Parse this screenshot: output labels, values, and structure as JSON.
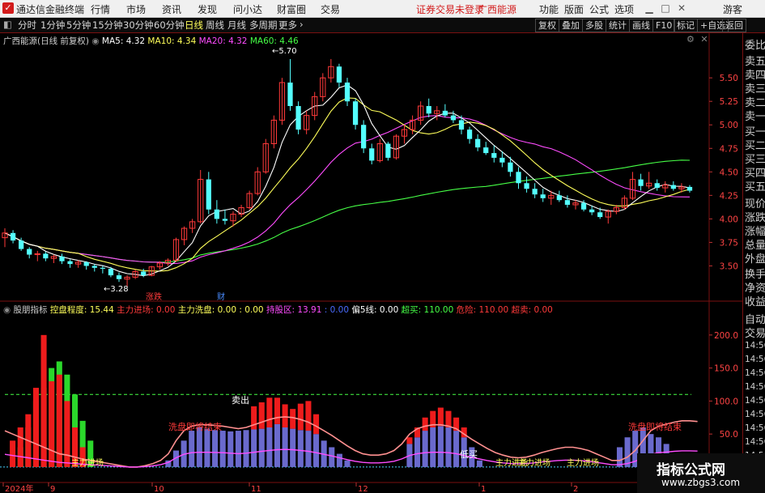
{
  "app": {
    "title": "通达信金融终端",
    "menu": [
      "行情",
      "市场",
      "资讯",
      "发现",
      "问小达",
      "财富圈",
      "交易"
    ],
    "alert": "证券交易未登录",
    "stock_name": "广西能源",
    "right_menu": [
      "功能",
      "版面",
      "公式",
      "选项"
    ],
    "guest": "游客"
  },
  "periods": [
    "分时",
    "1分钟",
    "5分钟",
    "15分钟",
    "30分钟",
    "60分钟",
    "日线",
    "周线",
    "月线",
    "多周期",
    "更多"
  ],
  "active_period": "日线",
  "toolbar": [
    "复权",
    "叠加",
    "多股",
    "统计",
    "画线",
    "F10",
    "标记",
    "+自选",
    "返回"
  ],
  "chart_header": {
    "stock_label": "广西能源(日线 前复权)",
    "ma": [
      {
        "label": "MA5: 4.32",
        "color": "#ffffff"
      },
      {
        "label": "MA10: 4.34",
        "color": "#ffff5a"
      },
      {
        "label": "MA20: 4.32",
        "color": "#ff4cff"
      },
      {
        "label": "MA60: 4.46",
        "color": "#46ff46"
      }
    ]
  },
  "indicator_header": {
    "name": "股朋指标",
    "items": [
      {
        "label": "控盘程度: 15.44",
        "color": "#ffff5a"
      },
      {
        "label": "主力进场: 0.00",
        "color": "#ff3a3a"
      },
      {
        "label": "主力洗盘: 0.00",
        "color": "#ffff5a"
      },
      {
        "label": ": 0.00",
        "color": "#ffff5a"
      },
      {
        "label": "持股区: 13.91",
        "color": "#ff4cff"
      },
      {
        "label": ": 0.00",
        "color": "#4a6bff"
      },
      {
        "label": "偏5线: 0.00",
        "color": "#ffffff"
      },
      {
        "label": "超买: 110.00",
        "color": "#46ff46"
      },
      {
        "label": "危险: 110.00",
        "color": "#ff3a3a"
      },
      {
        "label": "超卖: 0.00",
        "color": "#ff3a3a"
      }
    ]
  },
  "sidebar_labels": [
    "委比",
    "卖五",
    "卖四",
    "卖三",
    "卖二",
    "卖一",
    "买一",
    "买二",
    "买三",
    "买四",
    "买五",
    "现价",
    "涨跌",
    "涨幅",
    "总量",
    "外盘",
    "换手",
    "净资",
    "收益",
    "自动",
    "交易"
  ],
  "sidebar_times": [
    "14:56",
    "14:56",
    "14:56",
    "14:56",
    "14:56",
    "14:56",
    "14:56",
    "14:56",
    "14:56"
  ],
  "annotations": {
    "high": "5.70",
    "low": "3.28",
    "sell": "卖出",
    "low_buy": "低买",
    "buy_texts": [
      "主力进场",
      "主力进场",
      "主力进场",
      "主力进场"
    ],
    "wash_end": [
      "洗盘即将结束",
      "洗盘即将结束"
    ],
    "markers": [
      "涨跌",
      "财"
    ]
  },
  "x_labels": [
    "2024年",
    "9",
    "10",
    "11",
    "12",
    "1",
    "2"
  ],
  "watermark": {
    "line1": "指标公式网",
    "line2": "www.zbgs3.com"
  },
  "chart_data": {
    "type": "candlestick",
    "price_axis": {
      "ticks": [
        3.5,
        3.75,
        4.0,
        4.25,
        4.5,
        4.75,
        5.0,
        5.25,
        5.5
      ],
      "range": [
        3.22,
        5.82
      ]
    },
    "candles": [
      {
        "o": 3.8,
        "h": 3.9,
        "l": 3.7,
        "c": 3.85
      },
      {
        "o": 3.85,
        "h": 3.88,
        "l": 3.74,
        "c": 3.77
      },
      {
        "o": 3.77,
        "h": 3.8,
        "l": 3.66,
        "c": 3.68
      },
      {
        "o": 3.68,
        "h": 3.7,
        "l": 3.58,
        "c": 3.62
      },
      {
        "o": 3.62,
        "h": 3.66,
        "l": 3.55,
        "c": 3.63
      },
      {
        "o": 3.63,
        "h": 3.65,
        "l": 3.55,
        "c": 3.58
      },
      {
        "o": 3.58,
        "h": 3.62,
        "l": 3.53,
        "c": 3.6
      },
      {
        "o": 3.6,
        "h": 3.63,
        "l": 3.52,
        "c": 3.55
      },
      {
        "o": 3.55,
        "h": 3.57,
        "l": 3.48,
        "c": 3.52
      },
      {
        "o": 3.52,
        "h": 3.56,
        "l": 3.48,
        "c": 3.54
      },
      {
        "o": 3.54,
        "h": 3.55,
        "l": 3.46,
        "c": 3.5
      },
      {
        "o": 3.5,
        "h": 3.52,
        "l": 3.44,
        "c": 3.48
      },
      {
        "o": 3.48,
        "h": 3.5,
        "l": 3.42,
        "c": 3.47
      },
      {
        "o": 3.47,
        "h": 3.49,
        "l": 3.38,
        "c": 3.4
      },
      {
        "o": 3.4,
        "h": 3.43,
        "l": 3.33,
        "c": 3.36
      },
      {
        "o": 3.36,
        "h": 3.4,
        "l": 3.28,
        "c": 3.38
      },
      {
        "o": 3.38,
        "h": 3.46,
        "l": 3.36,
        "c": 3.44
      },
      {
        "o": 3.44,
        "h": 3.47,
        "l": 3.38,
        "c": 3.4
      },
      {
        "o": 3.4,
        "h": 3.5,
        "l": 3.39,
        "c": 3.49
      },
      {
        "o": 3.49,
        "h": 3.55,
        "l": 3.46,
        "c": 3.53
      },
      {
        "o": 3.53,
        "h": 3.58,
        "l": 3.5,
        "c": 3.56
      },
      {
        "o": 3.56,
        "h": 3.8,
        "l": 3.54,
        "c": 3.78
      },
      {
        "o": 3.78,
        "h": 3.92,
        "l": 3.72,
        "c": 3.9
      },
      {
        "o": 3.9,
        "h": 4.0,
        "l": 3.85,
        "c": 3.97
      },
      {
        "o": 3.97,
        "h": 4.52,
        "l": 3.95,
        "c": 4.42
      },
      {
        "o": 4.42,
        "h": 4.5,
        "l": 4.05,
        "c": 4.1
      },
      {
        "o": 4.1,
        "h": 4.2,
        "l": 3.95,
        "c": 4.0
      },
      {
        "o": 4.0,
        "h": 4.1,
        "l": 3.94,
        "c": 3.98
      },
      {
        "o": 3.98,
        "h": 4.08,
        "l": 3.92,
        "c": 4.05
      },
      {
        "o": 4.05,
        "h": 4.15,
        "l": 4.02,
        "c": 4.12
      },
      {
        "o": 4.12,
        "h": 4.3,
        "l": 4.1,
        "c": 4.27
      },
      {
        "o": 4.27,
        "h": 4.55,
        "l": 4.25,
        "c": 4.5
      },
      {
        "o": 4.5,
        "h": 4.85,
        "l": 4.48,
        "c": 4.8
      },
      {
        "o": 4.8,
        "h": 5.1,
        "l": 4.75,
        "c": 5.05
      },
      {
        "o": 5.05,
        "h": 5.5,
        "l": 5.0,
        "c": 5.45
      },
      {
        "o": 5.45,
        "h": 5.7,
        "l": 5.15,
        "c": 5.2
      },
      {
        "o": 5.2,
        "h": 5.25,
        "l": 4.9,
        "c": 4.95
      },
      {
        "o": 4.95,
        "h": 5.15,
        "l": 4.9,
        "c": 5.1
      },
      {
        "o": 5.1,
        "h": 5.35,
        "l": 5.05,
        "c": 5.3
      },
      {
        "o": 5.3,
        "h": 5.55,
        "l": 5.25,
        "c": 5.5
      },
      {
        "o": 5.5,
        "h": 5.7,
        "l": 5.45,
        "c": 5.62
      },
      {
        "o": 5.62,
        "h": 5.65,
        "l": 5.4,
        "c": 5.45
      },
      {
        "o": 5.45,
        "h": 5.5,
        "l": 5.2,
        "c": 5.25
      },
      {
        "o": 5.25,
        "h": 5.28,
        "l": 4.95,
        "c": 5.0
      },
      {
        "o": 5.0,
        "h": 5.05,
        "l": 4.7,
        "c": 4.75
      },
      {
        "o": 4.75,
        "h": 4.8,
        "l": 4.58,
        "c": 4.62
      },
      {
        "o": 4.62,
        "h": 4.85,
        "l": 4.6,
        "c": 4.8
      },
      {
        "o": 4.8,
        "h": 4.82,
        "l": 4.62,
        "c": 4.65
      },
      {
        "o": 4.65,
        "h": 4.9,
        "l": 4.63,
        "c": 4.88
      },
      {
        "o": 4.88,
        "h": 5.0,
        "l": 4.8,
        "c": 4.95
      },
      {
        "o": 4.95,
        "h": 5.1,
        "l": 4.9,
        "c": 5.05
      },
      {
        "o": 5.05,
        "h": 5.25,
        "l": 5.0,
        "c": 5.2
      },
      {
        "o": 5.2,
        "h": 5.28,
        "l": 5.08,
        "c": 5.12
      },
      {
        "o": 5.12,
        "h": 5.2,
        "l": 5.05,
        "c": 5.15
      },
      {
        "o": 5.15,
        "h": 5.22,
        "l": 5.08,
        "c": 5.1
      },
      {
        "o": 5.1,
        "h": 5.15,
        "l": 5.02,
        "c": 5.05
      },
      {
        "o": 5.05,
        "h": 5.1,
        "l": 4.9,
        "c": 4.95
      },
      {
        "o": 4.95,
        "h": 4.98,
        "l": 4.8,
        "c": 4.85
      },
      {
        "o": 4.85,
        "h": 4.9,
        "l": 4.72,
        "c": 4.76
      },
      {
        "o": 4.76,
        "h": 4.82,
        "l": 4.68,
        "c": 4.7
      },
      {
        "o": 4.7,
        "h": 4.78,
        "l": 4.6,
        "c": 4.65
      },
      {
        "o": 4.65,
        "h": 4.72,
        "l": 4.55,
        "c": 4.6
      },
      {
        "o": 4.6,
        "h": 4.66,
        "l": 4.45,
        "c": 4.5
      },
      {
        "o": 4.5,
        "h": 4.55,
        "l": 4.32,
        "c": 4.38
      },
      {
        "o": 4.38,
        "h": 4.45,
        "l": 4.28,
        "c": 4.32
      },
      {
        "o": 4.32,
        "h": 4.38,
        "l": 4.22,
        "c": 4.26
      },
      {
        "o": 4.26,
        "h": 4.32,
        "l": 4.18,
        "c": 4.22
      },
      {
        "o": 4.22,
        "h": 4.3,
        "l": 4.15,
        "c": 4.25
      },
      {
        "o": 4.25,
        "h": 4.3,
        "l": 4.18,
        "c": 4.2
      },
      {
        "o": 4.2,
        "h": 4.25,
        "l": 4.12,
        "c": 4.15
      },
      {
        "o": 4.15,
        "h": 4.2,
        "l": 4.1,
        "c": 4.17
      },
      {
        "o": 4.17,
        "h": 4.2,
        "l": 4.08,
        "c": 4.1
      },
      {
        "o": 4.1,
        "h": 4.14,
        "l": 4.04,
        "c": 4.07
      },
      {
        "o": 4.07,
        "h": 4.12,
        "l": 4.0,
        "c": 4.02
      },
      {
        "o": 4.02,
        "h": 4.1,
        "l": 3.95,
        "c": 4.08
      },
      {
        "o": 4.08,
        "h": 4.15,
        "l": 4.05,
        "c": 4.12
      },
      {
        "o": 4.12,
        "h": 4.25,
        "l": 4.1,
        "c": 4.22
      },
      {
        "o": 4.22,
        "h": 4.5,
        "l": 4.2,
        "c": 4.42
      },
      {
        "o": 4.42,
        "h": 4.48,
        "l": 4.3,
        "c": 4.35
      },
      {
        "o": 4.35,
        "h": 4.5,
        "l": 4.32,
        "c": 4.38
      },
      {
        "o": 4.38,
        "h": 4.42,
        "l": 4.3,
        "c": 4.33
      },
      {
        "o": 4.33,
        "h": 4.4,
        "l": 4.28,
        "c": 4.36
      },
      {
        "o": 4.36,
        "h": 4.4,
        "l": 4.3,
        "c": 4.32
      },
      {
        "o": 4.32,
        "h": 4.38,
        "l": 4.28,
        "c": 4.34
      },
      {
        "o": 4.34,
        "h": 4.36,
        "l": 4.28,
        "c": 4.3
      }
    ],
    "indicator": {
      "y_ticks": [
        50,
        100,
        150,
        200
      ],
      "range": [
        -5,
        228
      ],
      "bars_red": [
        0,
        40,
        60,
        80,
        120,
        200,
        130,
        140,
        100,
        60,
        30,
        0,
        0,
        0,
        0,
        0,
        0,
        0,
        0,
        0,
        0,
        0,
        0,
        0,
        0,
        0,
        0,
        0,
        0,
        0,
        0,
        0,
        0,
        0,
        0,
        0,
        0,
        0,
        0,
        0,
        0,
        0,
        0,
        0,
        0,
        0,
        0,
        0,
        0,
        0,
        0,
        0,
        0,
        0,
        0,
        0,
        0,
        0,
        0,
        0,
        0,
        0,
        0,
        0,
        0,
        0,
        0,
        0,
        0,
        0,
        0,
        0,
        0,
        0,
        0,
        0,
        0,
        0,
        0,
        0,
        0,
        0,
        0,
        0,
        0,
        0,
        0,
        0,
        0
      ],
      "bars_green": [
        0,
        0,
        30,
        60,
        100,
        120,
        150,
        160,
        140,
        110,
        70,
        40,
        0,
        0,
        0,
        0,
        0,
        0,
        0,
        0,
        0,
        0,
        0,
        0,
        0,
        0,
        0,
        0,
        0,
        0,
        0,
        0,
        0,
        0,
        0,
        0,
        0,
        0,
        0,
        0,
        0,
        0,
        0,
        0,
        0,
        0,
        0,
        0,
        0,
        0,
        0,
        0,
        0,
        0,
        0,
        0,
        0,
        0,
        0,
        0,
        0,
        0,
        0,
        0,
        0,
        0,
        0,
        0,
        0,
        0,
        0,
        0,
        0,
        0,
        0,
        0,
        0,
        0,
        0,
        0,
        0,
        0,
        0,
        0,
        0,
        0,
        0,
        0,
        0
      ],
      "bars_blue": [
        0,
        0,
        0,
        0,
        0,
        0,
        0,
        0,
        0,
        0,
        0,
        0,
        0,
        0,
        0,
        0,
        0,
        0,
        0,
        0,
        0,
        10,
        25,
        40,
        55,
        60,
        58,
        56,
        55,
        54,
        55,
        56,
        57,
        58,
        60,
        65,
        60,
        58,
        56,
        55,
        50,
        40,
        30,
        20,
        10,
        0,
        0,
        0,
        0,
        0,
        0,
        0,
        35,
        45,
        55,
        60,
        62,
        60,
        55,
        45,
        30,
        10,
        0,
        0,
        0,
        0,
        0,
        0,
        0,
        0,
        0,
        0,
        0,
        0,
        0,
        0,
        0,
        0,
        0,
        30,
        45,
        55,
        60,
        50,
        45,
        35,
        20,
        10
      ],
      "bars_upper_red": [
        0,
        0,
        0,
        0,
        0,
        0,
        0,
        0,
        0,
        0,
        0,
        0,
        0,
        0,
        0,
        0,
        0,
        0,
        0,
        0,
        0,
        0,
        0,
        0,
        0,
        0,
        0,
        0,
        0,
        0,
        0,
        0,
        35,
        40,
        45,
        40,
        35,
        30,
        40,
        45,
        30,
        0,
        0,
        0,
        0,
        0,
        0,
        0,
        0,
        0,
        0,
        0,
        10,
        15,
        20,
        25,
        28,
        25,
        20,
        15,
        0,
        0,
        0,
        0,
        0,
        0,
        0,
        0,
        0,
        0,
        0,
        0,
        0,
        0,
        0,
        0,
        0,
        0,
        0,
        0,
        0,
        0,
        0,
        0,
        0,
        0,
        0,
        0,
        0
      ],
      "pink_line": [
        55,
        50,
        45,
        40,
        35,
        30,
        25,
        20,
        18,
        15,
        12,
        10,
        8,
        6,
        4,
        2,
        0,
        0,
        2,
        5,
        10,
        20,
        40,
        55,
        62,
        64,
        64,
        63,
        62,
        60,
        58,
        60,
        64,
        68,
        72,
        75,
        76,
        75,
        72,
        68,
        62,
        55,
        48,
        40,
        32,
        25,
        20,
        18,
        18,
        20,
        25,
        35,
        50,
        58,
        62,
        64,
        64,
        62,
        58,
        50,
        42,
        35,
        28,
        22,
        18,
        15,
        14,
        15,
        18,
        22,
        25,
        28,
        30,
        30,
        28,
        25,
        20,
        15,
        10,
        10,
        15,
        25,
        40,
        55,
        62,
        65,
        68,
        70,
        70,
        69
      ]
    }
  }
}
